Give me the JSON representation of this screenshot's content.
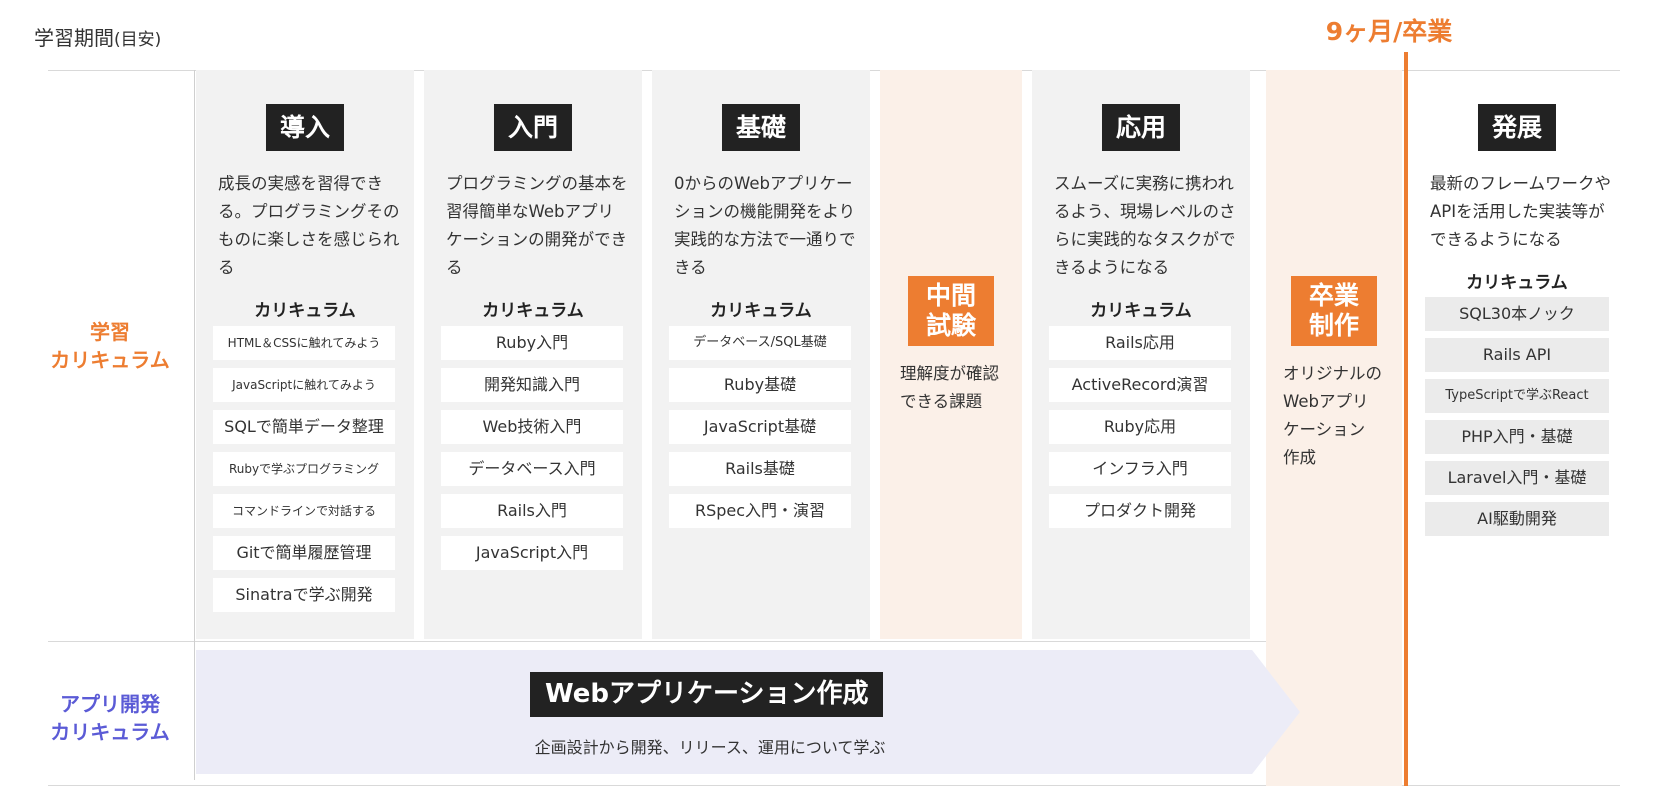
{
  "header": {
    "period_label": "学習期間",
    "period_sub": "(目安)",
    "graduation": "9ヶ月/卒業"
  },
  "rows": {
    "study_line1": "学習",
    "study_line2": "カリキュラム",
    "app_line1": "アプリ開発",
    "app_line2": "カリキュラム"
  },
  "curriculum_heading": "カリキュラム",
  "stages": [
    {
      "title": "導入",
      "desc": "成長の実感を習得できる。プログラミングそのものに楽しさを感じられる",
      "items": [
        "HTML＆CSSに触れてみよう",
        "JavaScriptに触れてみよう",
        "SQLで簡単データ整理",
        "Rubyで学ぶプログラミング",
        "コマンドラインで対話する",
        "Gitで簡単履歴管理",
        "Sinatraで学ぶ開発"
      ]
    },
    {
      "title": "入門",
      "desc": "プログラミングの基本を習得簡単なWebアプリケーションの開発ができる",
      "items": [
        "Ruby入門",
        "開発知識入門",
        "Web技術入門",
        "データベース入門",
        "Rails入門",
        "JavaScript入門"
      ]
    },
    {
      "title": "基礎",
      "desc": "0からのWebアプリケーションの機能開発をより実践的な方法で一通りできる",
      "items": [
        "データベース/SQL基礎",
        "Ruby基礎",
        "JavaScript基礎",
        "Rails基礎",
        "RSpec入門・演習"
      ]
    },
    {
      "title": "中間試験",
      "title_line1": "中間",
      "title_line2": "試験",
      "desc_line1": "理解度が確認",
      "desc_line2": "できる課題"
    },
    {
      "title": "応用",
      "desc": "スムーズに実務に携われるよう、現場レベルのさらに実践的なタスクができるようになる",
      "items": [
        "Rails応用",
        "ActiveRecord演習",
        "Ruby応用",
        "インフラ入門",
        "プロダクト開発"
      ]
    },
    {
      "title": "卒業制作",
      "title_line1": "卒業",
      "title_line2": "制作",
      "desc_line1": "オリジナルの",
      "desc_line2": "Webアプリ",
      "desc_line3": "ケーション",
      "desc_line4": "作成"
    },
    {
      "title": "発展",
      "desc": "最新のフレームワークやAPIを活用した実装等ができるようになる",
      "items": [
        "SQL30本ノック",
        "Rails API",
        "TypeScriptで学ぶReact",
        "PHP入門・基礎",
        "Laravel入門・基礎",
        "AI駆動開発"
      ]
    }
  ],
  "app_dev": {
    "title": "Webアプリケーション作成",
    "desc": "企画設計から開発、リリース、運用について学ぶ"
  },
  "colors": {
    "accent_orange": "#ed7d31",
    "accent_purple": "#5b5bd6",
    "stage_bg": "#f2f2f2",
    "peach_bg": "#fbf0e8",
    "band_bg": "#ececf7",
    "title_bg": "#222222"
  }
}
